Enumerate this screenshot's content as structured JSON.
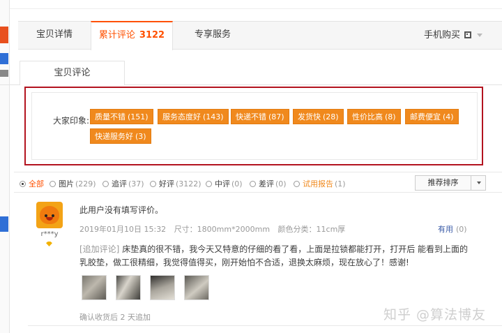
{
  "tabs": [
    {
      "label": "宝贝详情"
    },
    {
      "label": "累计评论",
      "count": "3122"
    },
    {
      "label": "专享服务"
    }
  ],
  "mobile_buy": {
    "label": "手机购买",
    "icon": "qr-code-icon"
  },
  "review_tab": {
    "label": "宝贝评论"
  },
  "impressions": {
    "label": "大家印象:",
    "tags": [
      {
        "text": "质量不错",
        "count": "(151)"
      },
      {
        "text": "服务态度好",
        "count": "(143)"
      },
      {
        "text": "快递不错",
        "count": "(87)"
      },
      {
        "text": "发货快",
        "count": "(28)"
      },
      {
        "text": "性价比高",
        "count": "(8)"
      },
      {
        "text": "邮费便宜",
        "count": "(4)"
      },
      {
        "text": "快递服务好",
        "count": "(3)"
      }
    ]
  },
  "filters": [
    {
      "label": "全部",
      "count": "",
      "selected": true
    },
    {
      "label": "图片",
      "count": "(229)",
      "selected": false
    },
    {
      "label": "追评",
      "count": "(37)",
      "selected": false
    },
    {
      "label": "好评",
      "count": "(3122)",
      "selected": false
    },
    {
      "label": "中评",
      "count": "(0)",
      "selected": false
    },
    {
      "label": "差评",
      "count": "(0)",
      "selected": false
    },
    {
      "label": "试用报告",
      "count": "(1)",
      "selected": false
    }
  ],
  "sort": {
    "label": "推荐排序"
  },
  "review": {
    "username": "r***y",
    "text": "此用户没有填写评价。",
    "date": "2019年01月10日 15:32",
    "size": "尺寸：1800mm*2000mm",
    "color": "颜色分类：11cm厚",
    "useful_label": "有用",
    "useful_count": "(0)",
    "append_tag": "[追加评论]",
    "append_text": "床垫真的很不错，我今天又特意的仔细的看了看，上面是拉锁都能打开，打开后 能看到上面的乳胶垫，做工很精细，我觉得值得买，刚开始怕不合适，退换太麻烦，现在放心了！感谢!",
    "confirm": "确认收货后 2 天追加"
  },
  "watermark": "知乎 @算法博友",
  "colors": {
    "accent": "#ff5000",
    "tag_bg": "#f0891d",
    "highlight_border": "#b3131f"
  }
}
